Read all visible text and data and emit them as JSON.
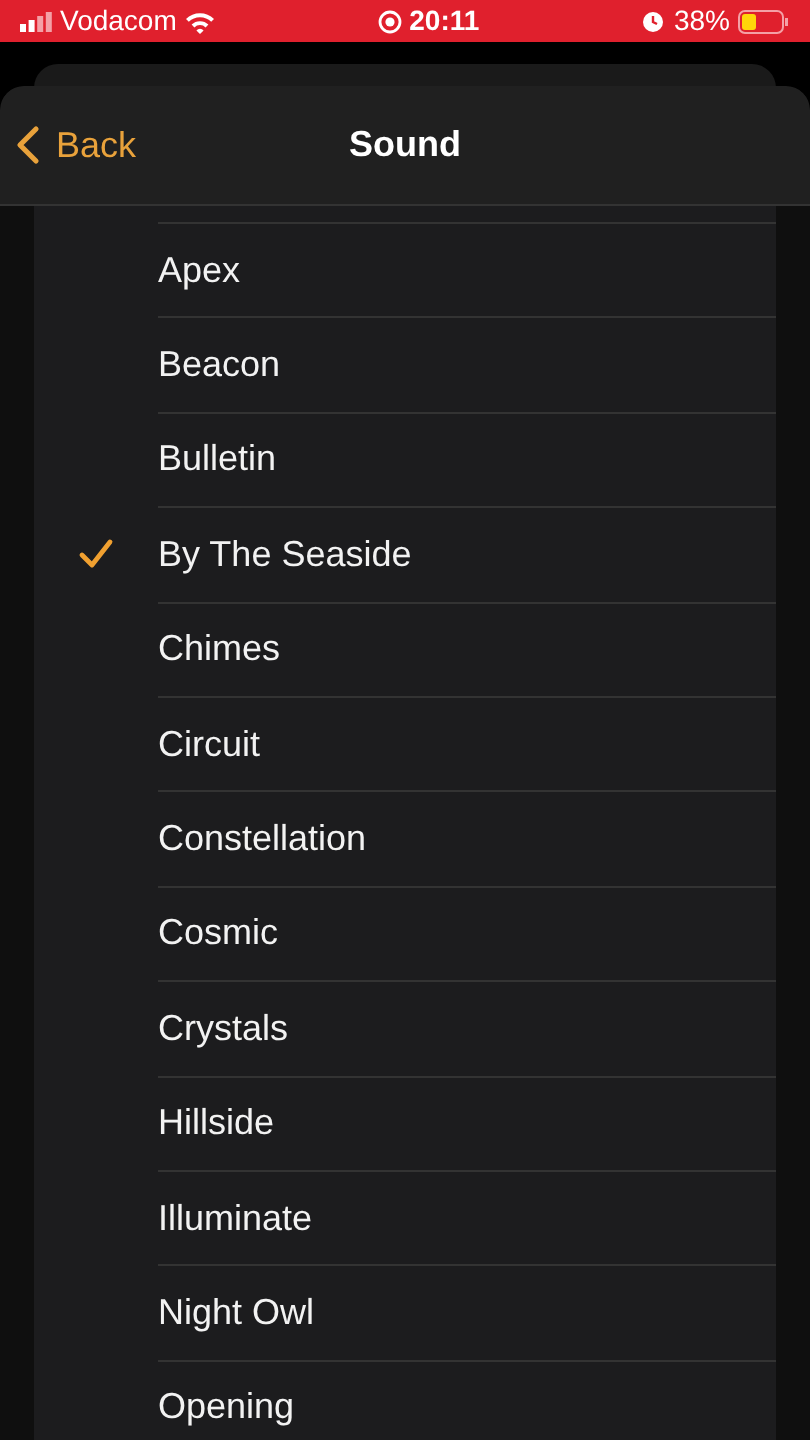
{
  "status_bar": {
    "carrier": "Vodacom",
    "time": "20:11",
    "battery": "38%"
  },
  "nav": {
    "back": "Back",
    "title": "Sound"
  },
  "sounds": [
    {
      "name": "Apex",
      "selected": false
    },
    {
      "name": "Beacon",
      "selected": false
    },
    {
      "name": "Bulletin",
      "selected": false
    },
    {
      "name": "By The Seaside",
      "selected": true
    },
    {
      "name": "Chimes",
      "selected": false
    },
    {
      "name": "Circuit",
      "selected": false
    },
    {
      "name": "Constellation",
      "selected": false
    },
    {
      "name": "Cosmic",
      "selected": false
    },
    {
      "name": "Crystals",
      "selected": false
    },
    {
      "name": "Hillside",
      "selected": false
    },
    {
      "name": "Illuminate",
      "selected": false
    },
    {
      "name": "Night Owl",
      "selected": false
    },
    {
      "name": "Opening",
      "selected": false
    }
  ]
}
